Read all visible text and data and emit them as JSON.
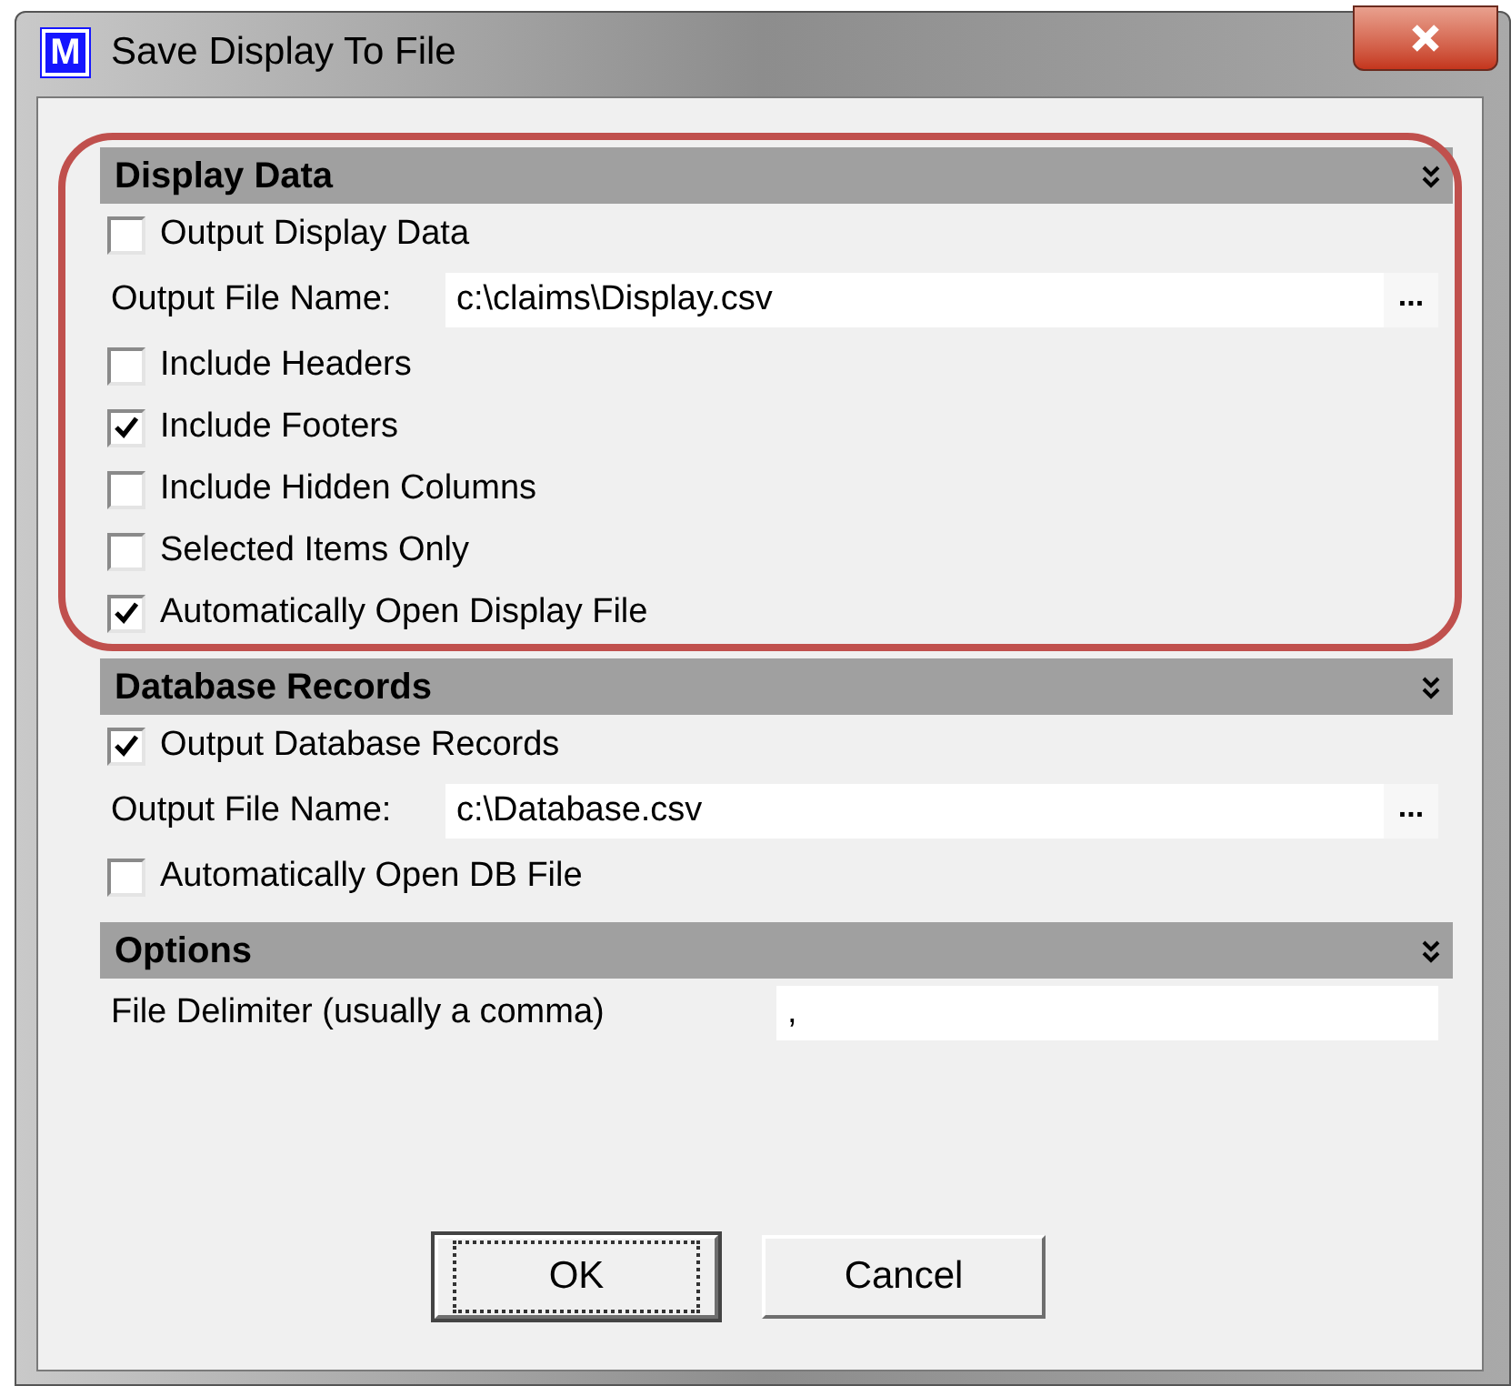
{
  "window": {
    "title": "Save Display To File",
    "app_icon": "M"
  },
  "sections": [
    {
      "title": "Display Data",
      "highlighted": true,
      "items": [
        {
          "kind": "checkbox",
          "label": "Output Display Data",
          "checked": false
        },
        {
          "kind": "file_field",
          "label": "Output File Name:",
          "value": "c:\\claims\\Display.csv",
          "browse": "..."
        },
        {
          "kind": "checkbox",
          "label": "Include Headers",
          "checked": false
        },
        {
          "kind": "checkbox",
          "label": "Include Footers",
          "checked": true
        },
        {
          "kind": "checkbox",
          "label": "Include Hidden Columns",
          "checked": false
        },
        {
          "kind": "checkbox",
          "label": "Selected Items Only",
          "checked": false
        },
        {
          "kind": "checkbox",
          "label": "Automatically Open Display File",
          "checked": true
        }
      ]
    },
    {
      "title": "Database Records",
      "highlighted": false,
      "items": [
        {
          "kind": "checkbox",
          "label": "Output Database Records",
          "checked": true
        },
        {
          "kind": "file_field",
          "label": "Output File Name:",
          "value": "c:\\Database.csv",
          "browse": "..."
        },
        {
          "kind": "checkbox",
          "label": "Automatically Open DB File",
          "checked": false
        }
      ]
    },
    {
      "title": "Options",
      "highlighted": false,
      "items": [
        {
          "kind": "text_field",
          "label": "File Delimiter (usually a comma)",
          "value": ","
        }
      ]
    }
  ],
  "buttons": [
    {
      "label": "OK",
      "focused": true
    },
    {
      "label": "Cancel",
      "focused": false
    }
  ]
}
